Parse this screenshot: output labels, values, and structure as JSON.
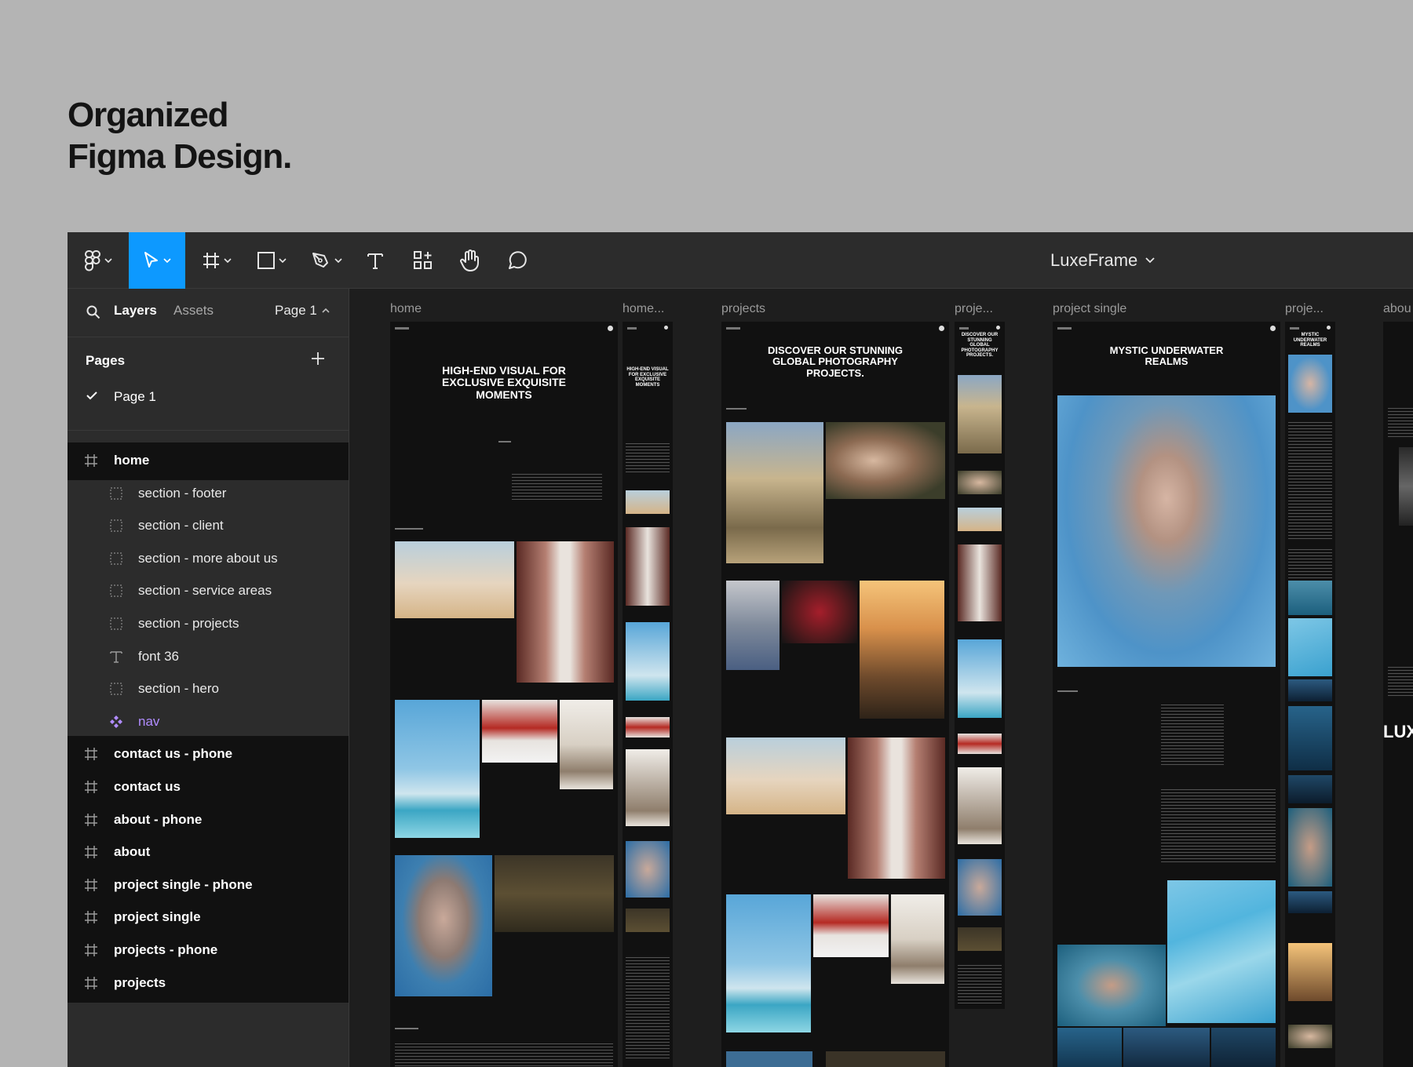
{
  "headline": {
    "line1": "Organized",
    "line2": "Figma Design."
  },
  "toolbar": {
    "file_name": "LuxeFrame",
    "tools": [
      "main-menu",
      "move",
      "frame",
      "shape",
      "pen",
      "text",
      "resources",
      "hand",
      "comment"
    ]
  },
  "sidebar": {
    "tab_layers": "Layers",
    "tab_assets": "Assets",
    "page_selector": "Page 1",
    "pages_heading": "Pages",
    "pages": [
      {
        "label": "Page 1",
        "selected": true
      }
    ],
    "layers": [
      {
        "label": "home",
        "type": "frame",
        "indent": 0
      },
      {
        "label": "section - footer",
        "type": "section",
        "indent": 1
      },
      {
        "label": "section - client",
        "type": "section",
        "indent": 1
      },
      {
        "label": "section - more about us",
        "type": "section",
        "indent": 1
      },
      {
        "label": "section - service areas",
        "type": "section",
        "indent": 1
      },
      {
        "label": "section - projects",
        "type": "section",
        "indent": 1
      },
      {
        "label": "font 36",
        "type": "text",
        "indent": 1
      },
      {
        "label": "section - hero",
        "type": "section",
        "indent": 1
      },
      {
        "label": "nav",
        "type": "component",
        "indent": 1
      },
      {
        "label": "contact us - phone",
        "type": "frame",
        "indent": 0
      },
      {
        "label": "contact us",
        "type": "frame",
        "indent": 0
      },
      {
        "label": "about - phone",
        "type": "frame",
        "indent": 0
      },
      {
        "label": "about",
        "type": "frame",
        "indent": 0
      },
      {
        "label": "project single - phone",
        "type": "frame",
        "indent": 0
      },
      {
        "label": "project single",
        "type": "frame",
        "indent": 0
      },
      {
        "label": "projects - phone",
        "type": "frame",
        "indent": 0
      },
      {
        "label": "projects",
        "type": "frame",
        "indent": 0
      }
    ]
  },
  "canvas": {
    "frame_labels": {
      "home": "home",
      "home_phone": "home...",
      "projects": "projects",
      "projects_phone": "proje...",
      "project_single": "project single",
      "project_single_phone": "proje...",
      "about": "abou"
    },
    "home_hero_title": "HIGH-END VISUAL FOR EXCLUSIVE EXQUISITE MOMENTS",
    "home_phone_title": "HIGH-END VISUAL FOR EXCLUSIVE EXQUISITE MOMENTS",
    "projects_title": "DISCOVER OUR STUNNING GLOBAL PHOTOGRAPHY PROJECTS.",
    "projects_phone_title": "DISCOVER OUR STUNNING GLOBAL PHOTOGRAPHY PROJECTS.",
    "project_single_title": "MYSTIC UNDERWATER REALMS",
    "project_single_phone_title": "MYSTIC UNDERWATER REALMS",
    "about_wordmark": "LUX"
  }
}
